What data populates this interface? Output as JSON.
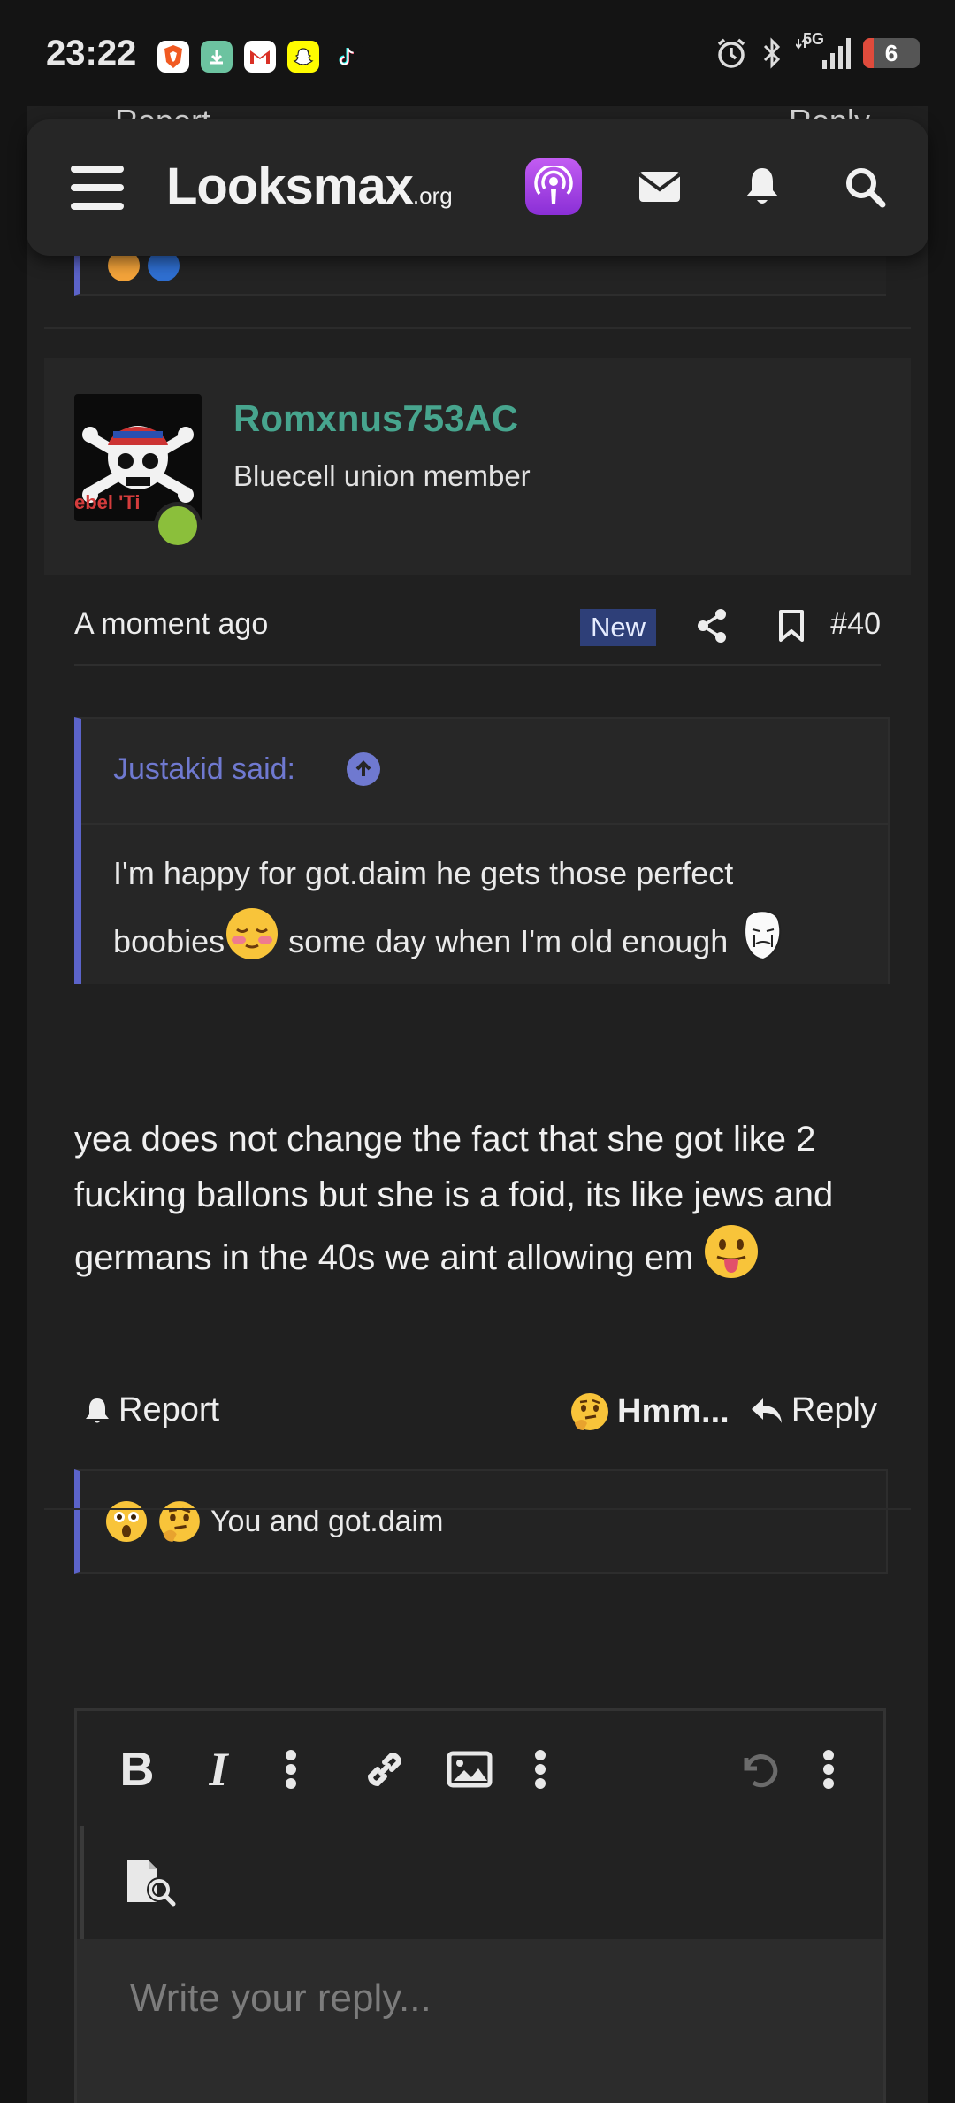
{
  "status_bar": {
    "time": "23:22",
    "network": "5G",
    "battery": "6",
    "app_icons": [
      "brave-icon",
      "download-icon",
      "gmail-icon",
      "snapchat-icon",
      "tiktok-icon"
    ]
  },
  "header": {
    "brand": "Looksmax",
    "brand_suffix": ".org",
    "icons": [
      "menu-icon",
      "podcast-icon",
      "mail-icon",
      "bell-icon",
      "search-icon"
    ]
  },
  "previous_post": {
    "left_fragment": "Report",
    "right_fragment": "Reply"
  },
  "post": {
    "username": "Romxnus753AC",
    "user_title": "Bluecell union member",
    "avatar_text": "ebel 'Ti",
    "time_ago": "A moment ago",
    "badge": "New",
    "post_number": "#40",
    "quote": {
      "author": "Justakid said:",
      "text_part1": "I'm happy for got.daim he gets those perfect boobies",
      "text_part2": " some day when I'm old enough "
    },
    "body": "yea does not change the fact that she got like 2 fucking ballons but she is a foid, its like jews and germans in the 40s we aint allowing em ",
    "actions": {
      "report": "Report",
      "reaction": "Hmm...",
      "reply": "Reply"
    },
    "reactions_summary": "You and got.daim"
  },
  "editor": {
    "placeholder": "Write your reply..."
  },
  "colors": {
    "username": "#47a58e",
    "quote_accent": "#5b63c9",
    "new_badge": "#2e3f78",
    "online": "#8bbf3b"
  }
}
